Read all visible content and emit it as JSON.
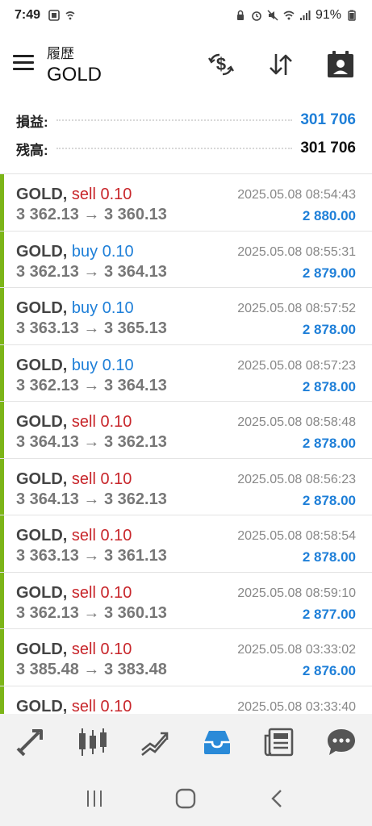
{
  "status_bar": {
    "time": "7:49",
    "battery": "91%"
  },
  "header": {
    "subtitle": "履歴",
    "title": "GOLD"
  },
  "summary": {
    "profit_label": "損益:",
    "profit_value": "301 706",
    "balance_label": "残高:",
    "balance_value": "301 706"
  },
  "trades": [
    {
      "symbol": "GOLD,",
      "side": "sell",
      "volume": "0.10",
      "prices": "3 362.13 → 3 360.13",
      "time": "2025.05.08 08:54:43",
      "profit": "2 880.00"
    },
    {
      "symbol": "GOLD,",
      "side": "buy",
      "volume": "0.10",
      "prices": "3 362.13 → 3 364.13",
      "time": "2025.05.08 08:55:31",
      "profit": "2 879.00"
    },
    {
      "symbol": "GOLD,",
      "side": "buy",
      "volume": "0.10",
      "prices": "3 363.13 → 3 365.13",
      "time": "2025.05.08 08:57:52",
      "profit": "2 878.00"
    },
    {
      "symbol": "GOLD,",
      "side": "buy",
      "volume": "0.10",
      "prices": "3 362.13 → 3 364.13",
      "time": "2025.05.08 08:57:23",
      "profit": "2 878.00"
    },
    {
      "symbol": "GOLD,",
      "side": "sell",
      "volume": "0.10",
      "prices": "3 364.13 → 3 362.13",
      "time": "2025.05.08 08:58:48",
      "profit": "2 878.00"
    },
    {
      "symbol": "GOLD,",
      "side": "sell",
      "volume": "0.10",
      "prices": "3 364.13 → 3 362.13",
      "time": "2025.05.08 08:56:23",
      "profit": "2 878.00"
    },
    {
      "symbol": "GOLD,",
      "side": "sell",
      "volume": "0.10",
      "prices": "3 363.13 → 3 361.13",
      "time": "2025.05.08 08:58:54",
      "profit": "2 878.00"
    },
    {
      "symbol": "GOLD,",
      "side": "sell",
      "volume": "0.10",
      "prices": "3 362.13 → 3 360.13",
      "time": "2025.05.08 08:59:10",
      "profit": "2 877.00"
    },
    {
      "symbol": "GOLD,",
      "side": "sell",
      "volume": "0.10",
      "prices": "3 385.48 → 3 383.48",
      "time": "2025.05.08 03:33:02",
      "profit": "2 876.00"
    },
    {
      "symbol": "GOLD,",
      "side": "sell",
      "volume": "0.10",
      "prices": "",
      "time": "2025.05.08 03:33:40",
      "profit": ""
    }
  ],
  "colors": {
    "accent_blue": "#1e7fd8",
    "sell_red": "#c8262b",
    "row_bar_green": "#7cb518",
    "active_tab": "#2a8ad8"
  },
  "bottom_nav": [
    {
      "icon": "quotes-icon",
      "active": false
    },
    {
      "icon": "chart-icon",
      "active": false
    },
    {
      "icon": "trade-icon",
      "active": false
    },
    {
      "icon": "history-icon",
      "active": true
    },
    {
      "icon": "news-icon",
      "active": false
    },
    {
      "icon": "messages-icon",
      "active": false
    }
  ]
}
